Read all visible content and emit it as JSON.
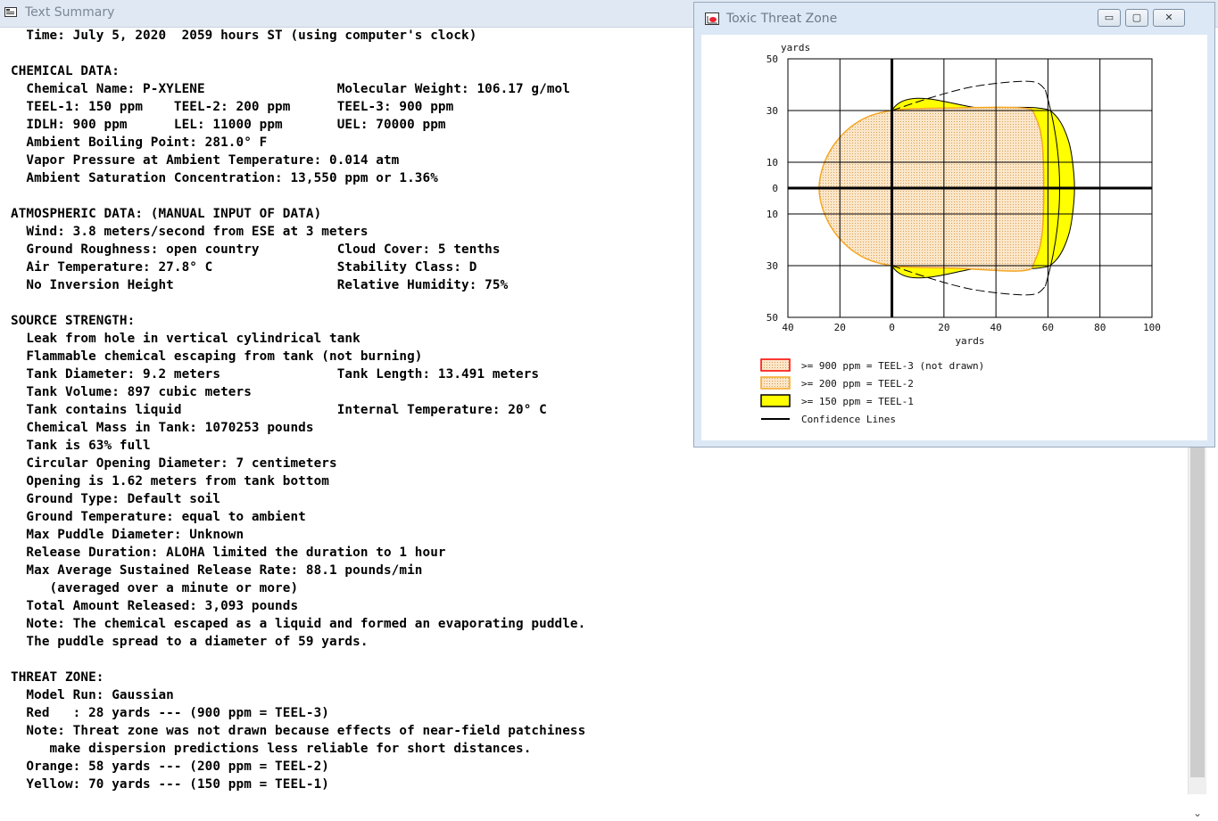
{
  "text_window": {
    "title": "Text Summary",
    "lines": [
      "  Time: July 5, 2020  2059 hours ST (using computer's clock)",
      "",
      "CHEMICAL DATA:",
      "  Chemical Name: P-XYLENE                 Molecular Weight: 106.17 g/mol",
      "  TEEL-1: 150 ppm    TEEL-2: 200 ppm      TEEL-3: 900 ppm",
      "  IDLH: 900 ppm      LEL: 11000 ppm       UEL: 70000 ppm",
      "  Ambient Boiling Point: 281.0° F",
      "  Vapor Pressure at Ambient Temperature: 0.014 atm",
      "  Ambient Saturation Concentration: 13,550 ppm or 1.36%",
      "",
      "ATMOSPHERIC DATA: (MANUAL INPUT OF DATA)",
      "  Wind: 3.8 meters/second from ESE at 3 meters",
      "  Ground Roughness: open country          Cloud Cover: 5 tenths",
      "  Air Temperature: 27.8° C                Stability Class: D",
      "  No Inversion Height                     Relative Humidity: 75%",
      "",
      "SOURCE STRENGTH:",
      "  Leak from hole in vertical cylindrical tank",
      "  Flammable chemical escaping from tank (not burning)",
      "  Tank Diameter: 9.2 meters               Tank Length: 13.491 meters",
      "  Tank Volume: 897 cubic meters",
      "  Tank contains liquid                    Internal Temperature: 20° C",
      "  Chemical Mass in Tank: 1070253 pounds",
      "  Tank is 63% full",
      "  Circular Opening Diameter: 7 centimeters",
      "  Opening is 1.62 meters from tank bottom",
      "  Ground Type: Default soil",
      "  Ground Temperature: equal to ambient",
      "  Max Puddle Diameter: Unknown",
      "  Release Duration: ALOHA limited the duration to 1 hour",
      "  Max Average Sustained Release Rate: 88.1 pounds/min",
      "     (averaged over a minute or more)",
      "  Total Amount Released: 3,093 pounds",
      "  Note: The chemical escaped as a liquid and formed an evaporating puddle.",
      "  The puddle spread to a diameter of 59 yards.",
      "",
      "THREAT ZONE:",
      "  Model Run: Gaussian",
      "  Red   : 28 yards --- (900 ppm = TEEL-3)",
      "  Note: Threat zone was not drawn because effects of near-field patchiness",
      "     make dispersion predictions less reliable for short distances.",
      "  Orange: 58 yards --- (200 ppm = TEEL-2)",
      "  Yellow: 70 yards --- (150 ppm = TEEL-1)"
    ]
  },
  "threat_window": {
    "title": "Toxic Threat Zone",
    "buttons": {
      "minimize": "▭",
      "maximize": "▢",
      "close": "✕"
    },
    "colors": {
      "red_zone": "#ff0000",
      "orange_zone": "#f5a623",
      "orange_fill": "#f7d9b0",
      "yellow_zone": "#ffff00",
      "grid": "#000000"
    },
    "chart_data": {
      "type": "area",
      "xlabel": "yards",
      "ylabel": "yards",
      "xlim": [
        -40,
        100
      ],
      "ylim": [
        -50,
        50
      ],
      "x_ticks": [
        -40,
        -20,
        0,
        20,
        40,
        60,
        80,
        100
      ],
      "x_tick_labels": [
        "40",
        "20",
        "0",
        "20",
        "40",
        "60",
        "80",
        "100"
      ],
      "y_ticks": [
        50,
        30,
        10,
        0,
        -10,
        -30,
        -50
      ],
      "y_tick_labels": [
        "50",
        "30",
        "10",
        "0",
        "10",
        "30",
        "50"
      ],
      "grid": true,
      "zones": [
        {
          "name": ">= 900 ppm = TEEL-3 (not drawn)",
          "color": "#ff0000",
          "max_x": 28
        },
        {
          "name": ">= 200 ppm = TEEL-2",
          "color": "#f5a623",
          "max_x": 58
        },
        {
          "name": ">= 150 ppm = TEEL-1",
          "color": "#ffff00",
          "max_x": 70
        }
      ],
      "yellow_outline": [
        [
          0,
          30
        ],
        [
          35,
          31
        ],
        [
          56,
          31
        ],
        [
          63,
          28
        ],
        [
          68,
          18
        ],
        [
          70,
          5
        ],
        [
          70,
          -5
        ],
        [
          68,
          -18
        ],
        [
          63,
          -28
        ],
        [
          56,
          -31
        ],
        [
          35,
          -31
        ],
        [
          0,
          -30
        ]
      ],
      "orange_outline": [
        [
          0,
          30
        ],
        [
          -14,
          25
        ],
        [
          -24,
          14
        ],
        [
          -28,
          0
        ],
        [
          -24,
          -14
        ],
        [
          -14,
          -25
        ],
        [
          0,
          -30
        ],
        [
          25,
          -31
        ],
        [
          50,
          -32
        ],
        [
          55,
          -28
        ],
        [
          58,
          -15
        ],
        [
          58,
          15
        ],
        [
          55,
          28
        ],
        [
          50,
          31
        ],
        [
          25,
          31
        ]
      ],
      "confidence_upper": [
        [
          0,
          30
        ],
        [
          15,
          35
        ],
        [
          30,
          39
        ],
        [
          45,
          41
        ],
        [
          55,
          41
        ],
        [
          59,
          38
        ]
      ],
      "confidence_lower": [
        [
          0,
          -30
        ],
        [
          15,
          -35
        ],
        [
          30,
          -39
        ],
        [
          45,
          -41
        ],
        [
          55,
          -41
        ],
        [
          59,
          -38
        ]
      ],
      "legend": [
        {
          "label": ">= 900 ppm = TEEL-3 (not drawn)",
          "swatch": "red"
        },
        {
          "label": ">= 200 ppm = TEEL-2",
          "swatch": "orange"
        },
        {
          "label": ">= 150 ppm = TEEL-1",
          "swatch": "yellow"
        },
        {
          "label": "Confidence Lines",
          "swatch": "line"
        }
      ]
    }
  }
}
